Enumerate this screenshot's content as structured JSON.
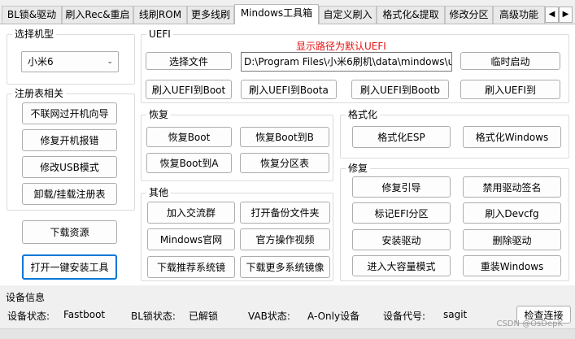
{
  "tabs": [
    {
      "label": "BL锁&驱动"
    },
    {
      "label": "刷入Rec&重启"
    },
    {
      "label": "线刷ROM"
    },
    {
      "label": "更多线刷"
    },
    {
      "label": "Mindows工具箱"
    },
    {
      "label": "自定义刷入"
    },
    {
      "label": "格式化&提取"
    },
    {
      "label": "修改分区"
    },
    {
      "label": "高级功能"
    }
  ],
  "tab_scroll": {
    "left": "◀",
    "right": "▶"
  },
  "model_group": {
    "title": "选择机型",
    "selected": "小米6",
    "chevron": "⌄"
  },
  "registry_group": {
    "title": "注册表相关",
    "buttons": [
      "不联网过开机向导",
      "修复开机报错",
      "修改USB模式",
      "卸载/挂载注册表"
    ]
  },
  "side_buttons": {
    "download": "下载资源",
    "open_installer": "打开一键安装工具"
  },
  "uefi_group": {
    "title": "UEFI",
    "notice": "显示路径为默认UEFI",
    "notice_color": "#e81010",
    "select_file": "选择文件",
    "path": "D:\\Program Files\\小米6刷机\\data\\mindows\\uefi",
    "temp_boot": "临时启动",
    "flash_buttons": [
      "刷入UEFI到Boot",
      "刷入UEFI到Boota",
      "刷入UEFI到Bootb",
      "刷入UEFI到"
    ]
  },
  "restore_group": {
    "title": "恢复",
    "buttons": [
      "恢复Boot",
      "恢复Boot到B",
      "恢复Boot到A",
      "恢复分区表"
    ]
  },
  "other_group": {
    "title": "其他",
    "buttons": [
      "加入交流群",
      "打开备份文件夹",
      "Mindows官网",
      "官方操作视频",
      "下载推荐系统镜",
      "下载更多系统镜像"
    ]
  },
  "format_group": {
    "title": "格式化",
    "buttons": [
      "格式化ESP",
      "格式化Windows"
    ]
  },
  "repair_group": {
    "title": "修复",
    "buttons": [
      "修复引导",
      "禁用驱动签名",
      "标记EFI分区",
      "刷入Devcfg",
      "安装驱动",
      "删除驱动",
      "进入大容量模式",
      "重装Windows"
    ]
  },
  "device_info": {
    "title": "设备信息",
    "status_label": "设备状态:",
    "status_value": "Fastboot",
    "bl_label": "BL锁状态:",
    "bl_value": "已解锁",
    "vab_label": "VAB状态:",
    "vab_value": "A-Only设备",
    "code_label": "设备代号:",
    "code_value": "sagit",
    "check_button": "检查连接"
  },
  "watermark": "CSDN @OsDepK"
}
